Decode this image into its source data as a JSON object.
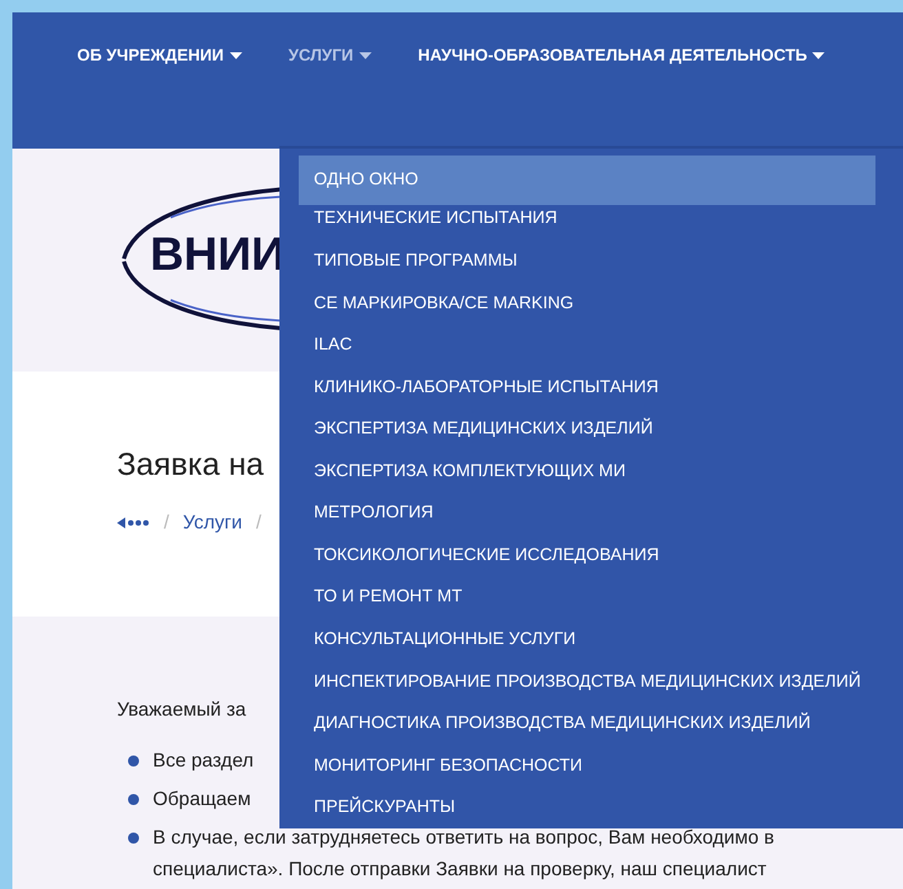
{
  "nav": [
    {
      "label": "ОБ УЧРЕЖДЕНИИ",
      "selected": false
    },
    {
      "label": "УСЛУГИ",
      "selected": true
    },
    {
      "label": "НАУЧНО-ОБРАЗОВАТЕЛЬНАЯ ДЕЯТЕЛЬНОСТЬ",
      "selected": false
    }
  ],
  "logo": {
    "text": "ВНИИ"
  },
  "page": {
    "title": "Заявка на",
    "breadcrumb": [
      {
        "kind": "separator",
        "text": "/"
      },
      {
        "kind": "link",
        "text": "Услуги"
      },
      {
        "kind": "separator",
        "text": "/"
      }
    ]
  },
  "content": {
    "greeting": "Уважаемый за",
    "bullets": [
      "Все раздел",
      "Обращаем",
      "В случае, если затрудняетесь ответить на вопрос, Вам необходимо в"
    ],
    "continuation": "специалиста». После отправки Заявки на проверку, наш специалист"
  },
  "dropdown": [
    {
      "label": "ОДНО ОКНО",
      "selected": true
    },
    {
      "label": "ТЕХНИЧЕСКИЕ ИСПЫТАНИЯ",
      "selected": false
    },
    {
      "label": "ТИПОВЫЕ ПРОГРАММЫ",
      "selected": false
    },
    {
      "label": "СЕ МАРКИРОВКА/CE MARKING",
      "selected": false
    },
    {
      "label": "ILAC",
      "selected": false
    },
    {
      "label": "КЛИНИКО-ЛАБОРАТОРНЫЕ ИСПЫТАНИЯ",
      "selected": false
    },
    {
      "label": "ЭКСПЕРТИЗА МЕДИЦИНСКИХ ИЗДЕЛИЙ",
      "selected": false
    },
    {
      "label": "ЭКСПЕРТИЗА КОМПЛЕКТУЮЩИХ МИ",
      "selected": false
    },
    {
      "label": "МЕТРОЛОГИЯ",
      "selected": false
    },
    {
      "label": "ТОКСИКОЛОГИЧЕСКИЕ ИССЛЕДОВАНИЯ",
      "selected": false
    },
    {
      "label": "ТО И РЕМОНТ МТ",
      "selected": false
    },
    {
      "label": "КОНСУЛЬТАЦИОННЫЕ УСЛУГИ",
      "selected": false
    },
    {
      "label": "ИНСПЕКТИРОВАНИЕ ПРОИЗВОДСТВА МЕДИЦИНСКИХ ИЗДЕЛИЙ",
      "selected": false
    },
    {
      "label": "ДИАГНОСТИКА ПРОИЗВОДСТВА МЕДИЦИНСКИХ ИЗДЕЛИЙ",
      "selected": false
    },
    {
      "label": "МОНИТОРИНГ БЕЗОПАСНОСТИ",
      "selected": false
    },
    {
      "label": "ПРЕЙСКУРАНТЫ",
      "selected": false
    }
  ]
}
